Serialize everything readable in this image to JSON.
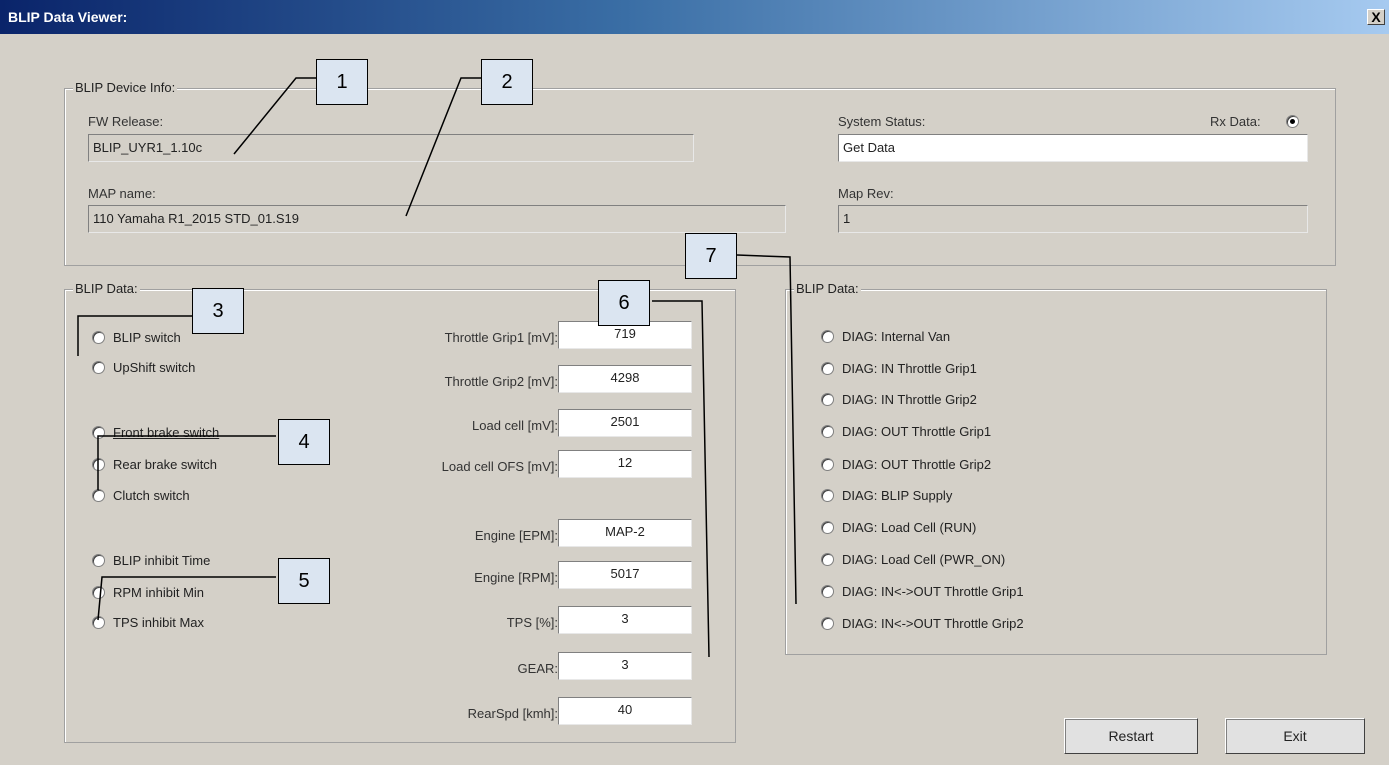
{
  "window": {
    "title": "BLIP Data Viewer:",
    "close_label": "X"
  },
  "device_info": {
    "group_title": "BLIP Device Info:",
    "fw_release_label": "FW Release:",
    "fw_release_value": "BLIP_UYR1_1.10c",
    "map_name_label": "MAP name:",
    "map_name_value": "110 Yamaha R1_2015 STD_01.S19",
    "system_status_label": "System Status:",
    "system_status_value": "Get Data",
    "rx_data_label": "Rx Data:",
    "map_rev_label": "Map Rev:",
    "map_rev_value": "1"
  },
  "blip_data_left": {
    "group_title": "BLIP Data:",
    "switches": [
      {
        "label": "BLIP switch",
        "checked": false
      },
      {
        "label": "UpShift switch",
        "checked": false
      },
      {
        "label": "Front brake switch",
        "checked": false
      },
      {
        "label": "Rear brake switch",
        "checked": false
      },
      {
        "label": "Clutch switch",
        "checked": false
      },
      {
        "label": "BLIP inhibit Time",
        "checked": false
      },
      {
        "label": "RPM inhibit Min",
        "checked": false
      },
      {
        "label": "TPS inhibit Max",
        "checked": false
      }
    ],
    "readings": [
      {
        "label": "Throttle Grip1 [mV]:",
        "value": "719"
      },
      {
        "label": "Throttle Grip2 [mV]:",
        "value": "4298"
      },
      {
        "label": "Load cell [mV]:",
        "value": "2501"
      },
      {
        "label": "Load cell OFS [mV]:",
        "value": "12"
      },
      {
        "label": "Engine [EPM]:",
        "value": "MAP-2"
      },
      {
        "label": "Engine [RPM]:",
        "value": "5017"
      },
      {
        "label": "TPS [%]:",
        "value": "3"
      },
      {
        "label": "GEAR:",
        "value": "3"
      },
      {
        "label": "RearSpd [kmh]:",
        "value": "40"
      }
    ]
  },
  "blip_data_right": {
    "group_title": "BLIP Data:",
    "diags": [
      "DIAG: Internal Van",
      "DIAG: IN Throttle Grip1",
      "DIAG: IN Throttle Grip2",
      "DIAG: OUT Throttle Grip1",
      "DIAG: OUT Throttle Grip2",
      "DIAG: BLIP Supply",
      "DIAG: Load Cell (RUN)",
      "DIAG: Load Cell (PWR_ON)",
      "DIAG: IN<->OUT Throttle Grip1",
      "DIAG: IN<->OUT Throttle Grip2"
    ]
  },
  "buttons": {
    "restart": "Restart",
    "exit": "Exit"
  },
  "callouts": [
    "1",
    "2",
    "3",
    "4",
    "5",
    "6",
    "7"
  ],
  "colors": {
    "title_start": "#0a246a",
    "title_end": "#a6caf0",
    "callout_fill": "#dbe5f1",
    "dialog_bg": "#d4d0c8"
  }
}
